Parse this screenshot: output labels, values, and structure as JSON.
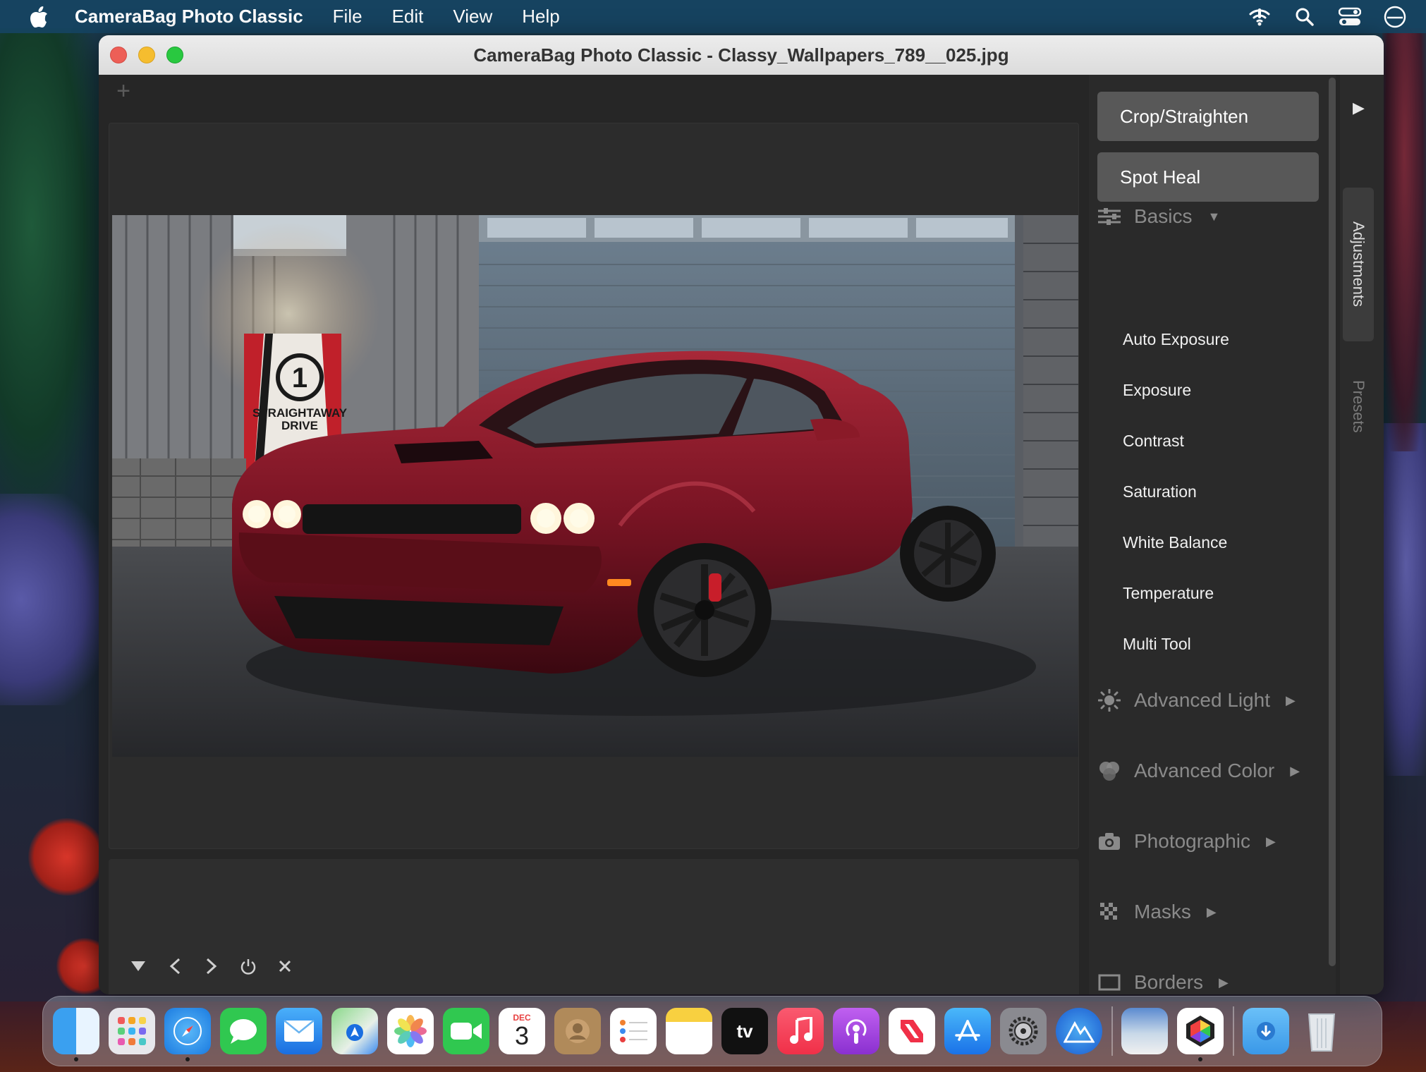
{
  "menubar": {
    "app_name": "CameraBag Photo Classic",
    "items": [
      "File",
      "Edit",
      "View",
      "Help"
    ]
  },
  "window": {
    "title": "CameraBag Photo Classic - Classy_Wallpapers_789__025.jpg"
  },
  "photo": {
    "sign_number": "1",
    "sign_line1": "STRAIGHTAWAY",
    "sign_line2": "DRIVE"
  },
  "side_panel": {
    "crop_label": "Crop/Straighten",
    "spot_heal_label": "Spot Heal",
    "basics_label": "Basics",
    "basics_items": [
      "Auto Exposure",
      "Exposure",
      "Contrast",
      "Saturation",
      "White Balance",
      "Temperature",
      "Multi Tool"
    ],
    "advanced_light_label": "Advanced Light",
    "advanced_color_label": "Advanced Color",
    "photographic_label": "Photographic",
    "masks_label": "Masks",
    "borders_label": "Borders"
  },
  "vertical_tabs": {
    "adjustments": "Adjustments",
    "presets": "Presets"
  },
  "dock": {
    "calendar_month": "DEC",
    "calendar_day": "3",
    "tv_label": "tv"
  },
  "colors": {
    "accent_button": "#585858",
    "panel_bg": "#2a2a2a",
    "car_red": "#7a1424"
  }
}
